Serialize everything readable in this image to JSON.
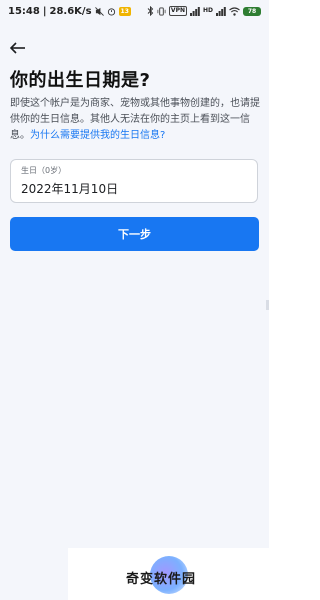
{
  "status_bar": {
    "time": "15:48",
    "network_speed": "28.6K/s",
    "badge": "13",
    "vpn": "VPN",
    "network_type": "HD",
    "battery": "78"
  },
  "header": {
    "back_icon": "arrow-left-icon",
    "title": "你的出生日期是?"
  },
  "description": {
    "text": "即使这个帐户是为商家、宠物或其他事物创建的，也请提供你的生日信息。其他人无法在你的主页上看到这一信息。",
    "link": "为什么需要提供我的生日信息?"
  },
  "birthday_field": {
    "label": "生日（0岁）",
    "value": "2022年11月10日"
  },
  "next_button": {
    "label": "下一步"
  },
  "watermark": {
    "text": "奇变软件园"
  },
  "colors": {
    "accent": "#1877f2",
    "background": "#f4f6fb"
  }
}
